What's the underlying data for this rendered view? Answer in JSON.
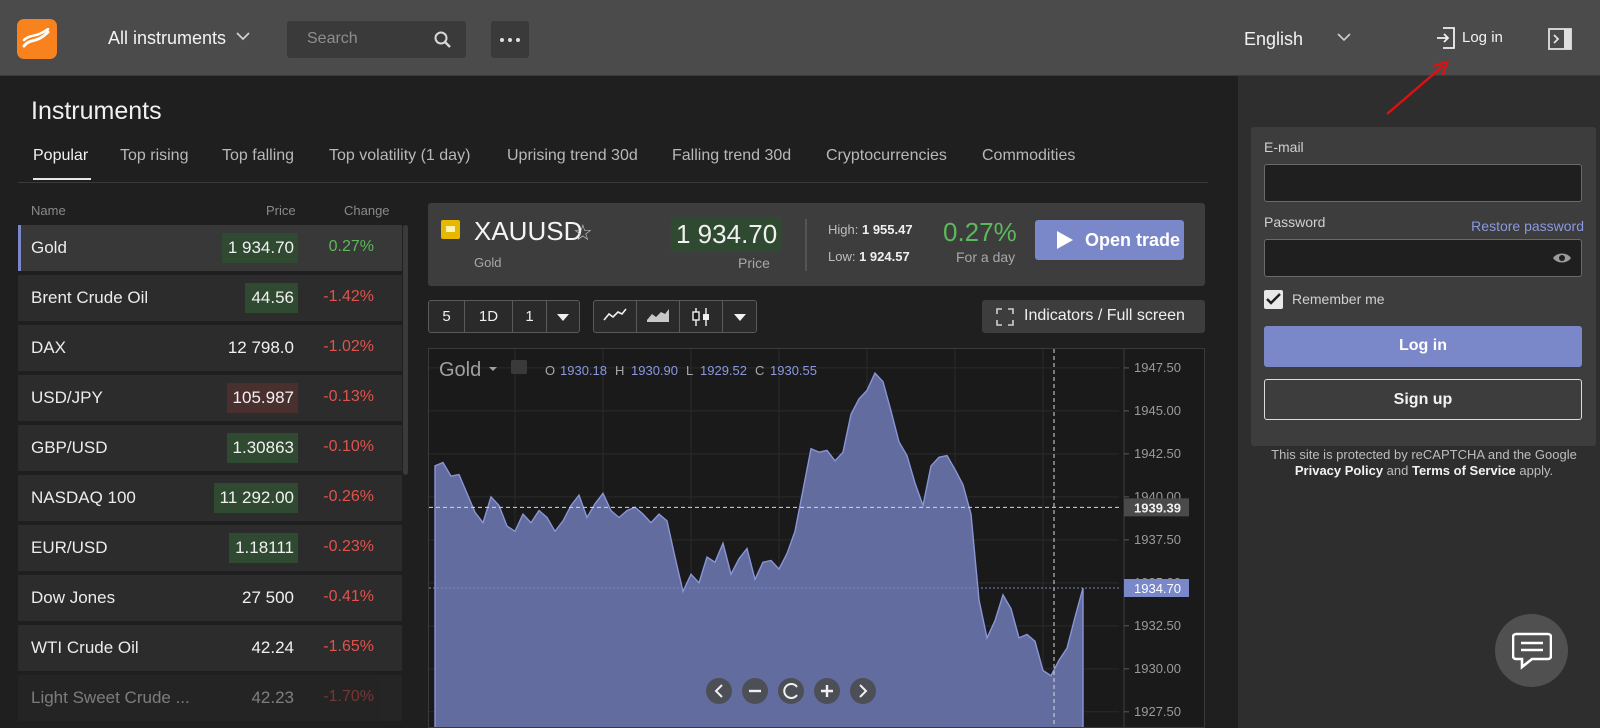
{
  "header": {
    "instruments_dropdown": "All instruments",
    "search_placeholder": "Search",
    "language": "English",
    "login_label": "Log in"
  },
  "instruments": {
    "title": "Instruments",
    "tabs": [
      "Popular",
      "Top rising",
      "Top falling",
      "Top volatility (1 day)",
      "Uprising trend 30d",
      "Falling trend 30d",
      "Cryptocurrencies",
      "Commodities"
    ],
    "columns": {
      "name": "Name",
      "price": "Price",
      "change": "Change"
    },
    "rows": [
      {
        "name": "Gold",
        "price": "1 934.70",
        "change": "0.27%",
        "direction": "up",
        "selected": true
      },
      {
        "name": "Brent Crude Oil",
        "price": "44.56",
        "change": "-1.42%",
        "direction": "up"
      },
      {
        "name": "DAX",
        "price": "12 798.0",
        "change": "-1.02%",
        "direction": "none"
      },
      {
        "name": "USD/JPY",
        "price": "105.987",
        "change": "-0.13%",
        "direction": "down"
      },
      {
        "name": "GBP/USD",
        "price": "1.30863",
        "change": "-0.10%",
        "direction": "up"
      },
      {
        "name": "NASDAQ 100",
        "price": "11 292.00",
        "change": "-0.26%",
        "direction": "up"
      },
      {
        "name": "EUR/USD",
        "price": "1.18111",
        "change": "-0.23%",
        "direction": "up"
      },
      {
        "name": "Dow Jones",
        "price": "27 500",
        "change": "-0.41%",
        "direction": "none"
      },
      {
        "name": "WTI Crude Oil",
        "price": "42.24",
        "change": "-1.65%",
        "direction": "none"
      },
      {
        "name": "Light Sweet Crude ...",
        "price": "42.23",
        "change": "-1.70%",
        "direction": "none"
      }
    ]
  },
  "quote": {
    "symbol": "XAUUSD",
    "subtitle": "Gold",
    "price": "1 934.70",
    "price_label": "Price",
    "high_label": "High:",
    "high": "1 955.47",
    "low_label": "Low:",
    "low": "1 924.57",
    "change_pct": "0.27%",
    "change_label": "For a day",
    "open_trade": "Open trade"
  },
  "chart_toolbar": {
    "interval_value": "5",
    "period": "1D",
    "count": "1",
    "indicators_label": "Indicators / Full screen"
  },
  "chart_data": {
    "type": "area",
    "title": "Gold",
    "ohlc": {
      "o_label": "O",
      "o": "1930.18",
      "h_label": "H",
      "h": "1930.90",
      "l_label": "L",
      "l": "1929.52",
      "c_label": "C",
      "c": "1930.55"
    },
    "y_ticks": [
      "1947.50",
      "1945.00",
      "1942.50",
      "1940.00",
      "1937.50",
      "1935.00",
      "1932.50",
      "1930.00",
      "1927.50"
    ],
    "ylim": [
      1926.5,
      1948.6
    ],
    "crosshair_value": "1939.39",
    "last_price_label": "1934.70",
    "values": [
      1941.8,
      1942.0,
      1941.2,
      1941.3,
      1940.2,
      1939.1,
      1938.5,
      1940.0,
      1939.5,
      1938.3,
      1938.0,
      1939.0,
      1938.5,
      1939.2,
      1938.8,
      1938.0,
      1938.6,
      1939.5,
      1940.1,
      1938.8,
      1939.6,
      1940.2,
      1939.2,
      1938.8,
      1939.2,
      1939.4,
      1939.0,
      1938.5,
      1939.0,
      1938.6,
      1936.5,
      1934.5,
      1935.5,
      1935.0,
      1936.5,
      1936.2,
      1937.3,
      1935.5,
      1936.4,
      1937.0,
      1935.2,
      1936.2,
      1936.3,
      1935.8,
      1936.7,
      1938.0,
      1940.4,
      1942.8,
      1942.6,
      1942.7,
      1942.1,
      1942.6,
      1944.8,
      1945.7,
      1946.2,
      1947.2,
      1946.7,
      1945.0,
      1943.2,
      1942.4,
      1940.8,
      1939.5,
      1941.8,
      1942.3,
      1942.4,
      1941.6,
      1940.7,
      1939.0,
      1934.0,
      1931.8,
      1932.8,
      1934.3,
      1933.5,
      1931.8,
      1932.0,
      1931.6,
      1929.9,
      1929.6,
      1930.5,
      1931.2,
      1933.0,
      1934.7
    ]
  },
  "login_form": {
    "email_label": "E-mail",
    "password_label": "Password",
    "restore_password": "Restore password",
    "remember_me": "Remember me",
    "login_button": "Log in",
    "signup_button": "Sign up",
    "recaptcha_pre": "This site is protected by reCAPTCHA and the Google ",
    "privacy_policy": "Privacy Policy",
    "and": " and ",
    "terms": "Terms of Service",
    "recaptcha_post": " apply."
  },
  "colors": {
    "accent": "#7a87c8",
    "positive": "#5cb85c",
    "negative": "#e0534d",
    "logo": "#f7821e"
  }
}
